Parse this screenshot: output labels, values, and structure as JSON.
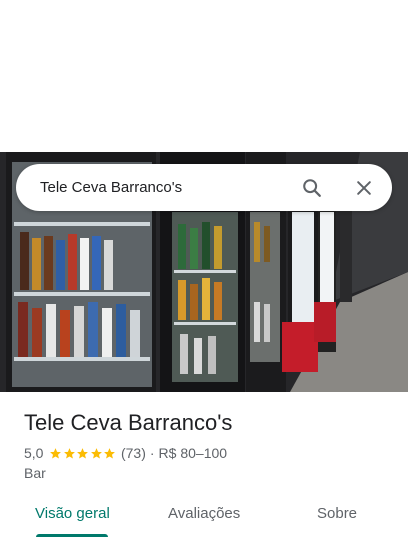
{
  "search": {
    "query": "Tele Ceva Barranco's"
  },
  "place": {
    "name": "Tele Ceva Barranco's",
    "rating": "5,0",
    "stars": 5,
    "reviews": "(73)",
    "separator": "·",
    "price": "R$ 80–100",
    "category": "Bar"
  },
  "tabs": [
    {
      "label": "Visão geral",
      "active": true
    },
    {
      "label": "Avaliações",
      "active": false
    },
    {
      "label": "Sobre",
      "active": false
    }
  ],
  "colors": {
    "accent": "#00796b",
    "star": "#fbbc04",
    "text": "#202124",
    "secondary": "#5f6368"
  },
  "icons": {
    "search": "search-icon",
    "close": "close-icon",
    "star": "star-icon"
  }
}
